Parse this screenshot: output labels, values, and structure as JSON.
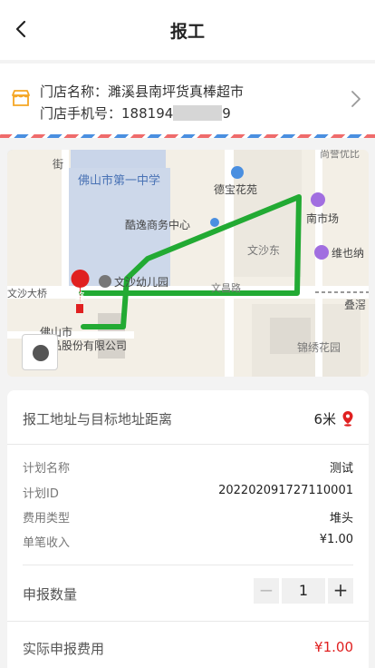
{
  "nav": {
    "title": "报工"
  },
  "store": {
    "name_label": "门店名称：",
    "name": "濉溪县南坪货真棒超市",
    "phone_label": "门店手机号：",
    "phone_prefix": "188194",
    "phone_suffix": "9"
  },
  "map": {
    "labels": {
      "school": "佛山市第一中学",
      "garden": "德宝花苑",
      "business": "酷逸商务中心",
      "market": "南市场",
      "wenshadong": "文沙东",
      "weiyena": "维也纳",
      "kindergarten": "文沙幼儿园",
      "bridge": "文沙大桥",
      "company_line1": "佛山市",
      "company_line2": "品股份有限公司",
      "jinxiu": "锦绣花园",
      "diejiao": "叠滘",
      "street": "街",
      "road": "文昌路",
      "top_right": "尚誉优比",
      "end_marker": "终"
    }
  },
  "details": {
    "distance_label": "报工地址与目标地址距离",
    "distance_value": "6米",
    "plan_name_label": "计划名称",
    "plan_name": "测试",
    "plan_id_label": "计划ID",
    "plan_id": "20220209172711000​1",
    "fee_type_label": "费用类型",
    "fee_type": "堆头",
    "unit_income_label": "单笔收入",
    "unit_income": "¥1.00",
    "quantity_label": "申报数量",
    "quantity": "1",
    "minus": "−",
    "plus": "+",
    "actual_fee_label": "实际申报费用",
    "actual_fee": "¥1.00"
  },
  "colors": {
    "route": "#22aa33",
    "accent_red": "#e02020",
    "store_icon": "#f5a623"
  }
}
